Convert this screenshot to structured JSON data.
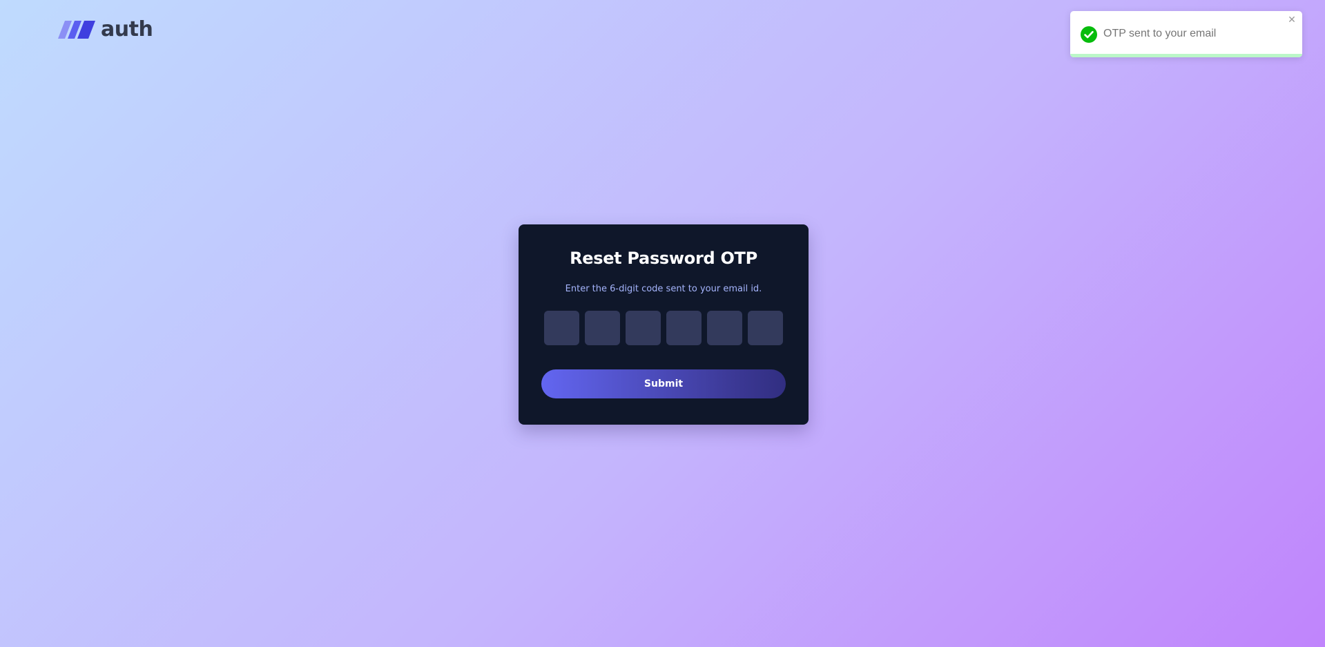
{
  "logo": {
    "text": "auth",
    "icon": "logo-stripes-icon"
  },
  "card": {
    "title": "Reset Password OTP",
    "subtitle": "Enter the 6-digit code sent to your email id.",
    "otp_digits": [
      "",
      "",
      "",
      "",
      "",
      ""
    ],
    "submit_label": "Submit"
  },
  "toast": {
    "message": "OTP sent to your email",
    "icon": "check-circle-icon",
    "close_icon": "close-icon",
    "progress_remaining": 1.0,
    "success_color": "#07bc0c"
  },
  "colors": {
    "card_background": "#0f172a",
    "subtitle": "#a5b4fc",
    "otp_box": "#333a5c",
    "button_start": "#6366f1",
    "button_end": "#312e81",
    "page_gradient_start": "#bfdbfe",
    "page_gradient_end": "#c084fc"
  }
}
